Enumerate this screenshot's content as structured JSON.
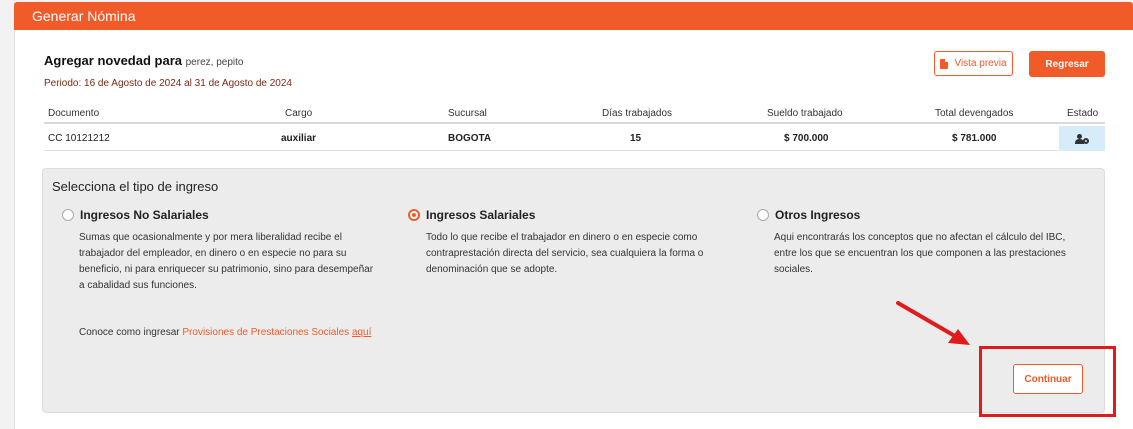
{
  "header": {
    "title": "Generar Nómina"
  },
  "novedad": {
    "title": "Agregar novedad para",
    "employee": "perez, pepito",
    "periodo": "Periodo: 16 de Agosto de 2024 al 31 de Agosto de 2024"
  },
  "toolbar": {
    "preview_label": "Vista previa",
    "back_label": "Regresar"
  },
  "table": {
    "headers": [
      "Documento",
      "Cargo",
      "Sucursal",
      "Días trabajados",
      "Sueldo trabajado",
      "Total devengados",
      "Estado"
    ],
    "row": {
      "documento": "CC 10121212",
      "cargo": "auxiliar",
      "sucursal": "BOGOTA",
      "dias": "15",
      "sueldo": "$ 700.000",
      "total": "$ 781.000"
    }
  },
  "ingreso": {
    "title": "Selecciona el tipo de ingreso",
    "options": [
      {
        "label": "Ingresos No Salariales",
        "checked": false,
        "lines": [
          "Sumas que ocasionalmente y por mera liberalidad recibe el",
          "trabajador del empleador, en dinero o en especie no para su",
          "beneficio, ni para enriquecer su patrimonio, sino para desempeñar",
          "a cabalidad sus funciones."
        ]
      },
      {
        "label": "Ingresos Salariales",
        "checked": true,
        "lines": [
          "Todo lo que recibe el trabajador en dinero o en especie como",
          "contraprestación directa del servicio, sea cualquiera la forma o",
          "denominación que se adopte."
        ]
      },
      {
        "label": "Otros Ingresos",
        "checked": false,
        "lines": [
          "Aqui encontrarás los conceptos que no afectan el cálculo del IBC,",
          "entre los que se encuentran los que componen a las prestaciones",
          "sociales."
        ]
      }
    ],
    "conoce_prefix": "Conoce como ingresar ",
    "conoce_link": "Provisiones de Prestaciones Sociales",
    "conoce_aqui": "aquí",
    "continue_label": "Continuar"
  },
  "colors": {
    "accent": "#f15a29",
    "annotation": "#e01b1b",
    "estado_bg": "#d6ecf8"
  }
}
